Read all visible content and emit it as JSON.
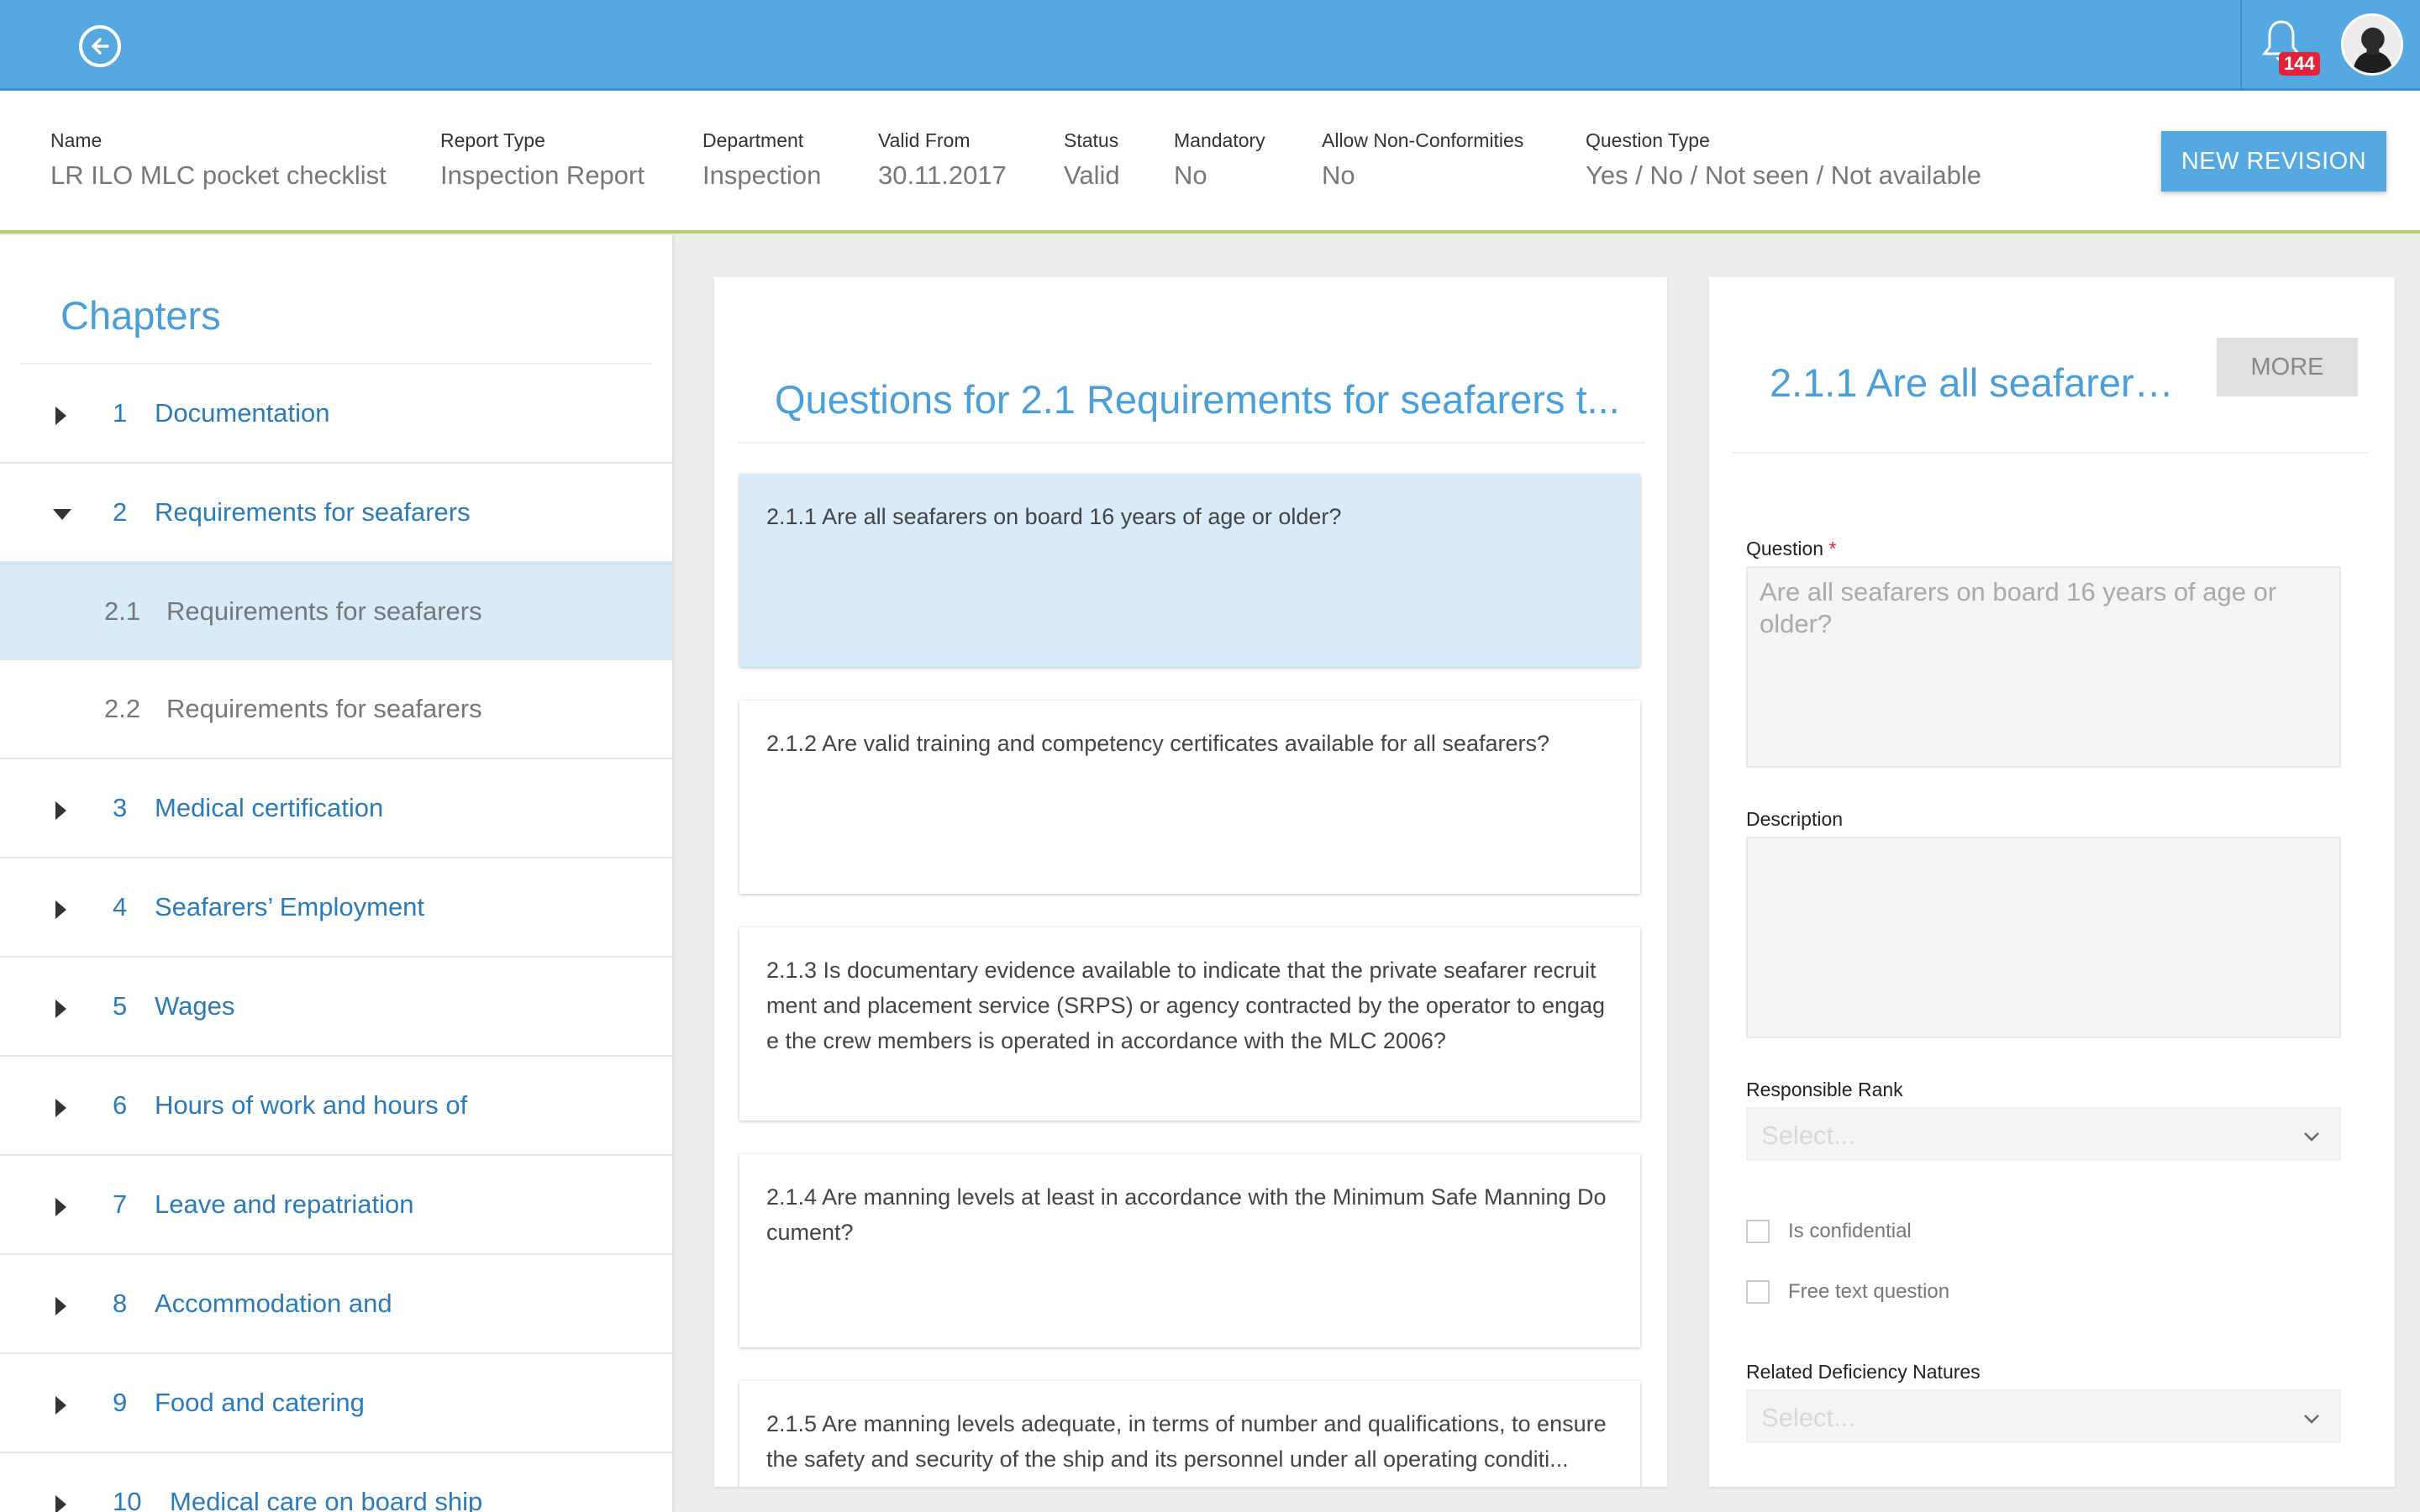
{
  "header": {
    "notification_count": "144"
  },
  "info": {
    "fields": [
      {
        "label": "Name",
        "value": "LR ILO MLC pocket checklist"
      },
      {
        "label": "Report Type",
        "value": "Inspection Report"
      },
      {
        "label": "Department",
        "value": "Inspection"
      },
      {
        "label": "Valid From",
        "value": "30.11.2017"
      },
      {
        "label": "Status",
        "value": "Valid"
      },
      {
        "label": "Mandatory",
        "value": "No"
      },
      {
        "label": "Allow Non-Conformities",
        "value": "No"
      },
      {
        "label": "Question Type",
        "value": "Yes / No / Not seen / Not available"
      }
    ],
    "new_revision_label": "NEW REVISION"
  },
  "sidebar": {
    "title": "Chapters",
    "chapters": [
      {
        "num": "1",
        "label": "Documentation"
      },
      {
        "num": "2",
        "label": "Requirements for seafarers"
      },
      {
        "num": "2.1",
        "label": "Requirements for seafarers"
      },
      {
        "num": "2.2",
        "label": "Requirements for seafarers"
      },
      {
        "num": "3",
        "label": "Medical certification"
      },
      {
        "num": "4",
        "label": "Seafarers’ Employment"
      },
      {
        "num": "5",
        "label": "Wages"
      },
      {
        "num": "6",
        "label": "Hours of work and hours of"
      },
      {
        "num": "7",
        "label": "Leave and repatriation"
      },
      {
        "num": "8",
        "label": "Accommodation and"
      },
      {
        "num": "9",
        "label": "Food and catering"
      },
      {
        "num": "10",
        "label": "Medical care on board ship"
      }
    ]
  },
  "questions": {
    "title": "Questions for 2.1 Requirements for seafarers t...",
    "items": [
      "2.1.1 Are all seafarers on board 16 years of age or older?",
      "2.1.2 Are valid training and competency certificates available for all seafarers?",
      "2.1.3 Is documentary evidence available to indicate that the private seafarer recruitment and placement service (SRPS) or agency contracted by the operator to engage the crew members is operated in accordance with the MLC 2006?",
      "2.1.4 Are manning levels at least in accordance with the Minimum Safe Manning Document?",
      "2.1.5 Are manning levels adequate, in terms of number and qualifications, to ensure the safety and security of the ship and its personnel under all operating conditi..."
    ]
  },
  "detail": {
    "title": "2.1.1 Are all seafarers ...",
    "more_label": "MORE",
    "question_label": "Question",
    "required_mark": "*",
    "question_value": "Are all seafarers on board 16 years of age or older?",
    "description_label": "Description",
    "description_value": "",
    "rank_label": "Responsible Rank",
    "rank_placeholder": "Select...",
    "confidential_label": "Is confidential",
    "free_text_label": "Free text question",
    "deficiency_label": "Related Deficiency Natures",
    "deficiency_placeholder": "Select..."
  }
}
